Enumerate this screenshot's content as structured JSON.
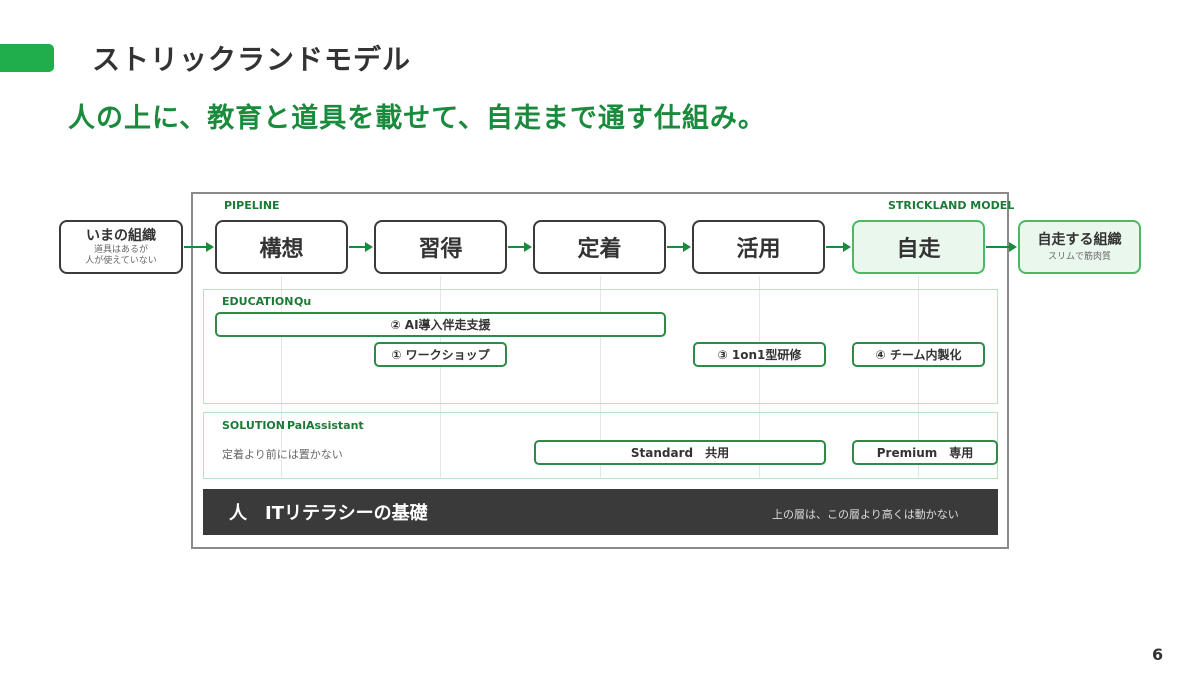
{
  "title": "ストリックランドモデル",
  "subtitle": "人の上に、教育と道具を載せて、自走まで通す仕組み。",
  "page_number": "6",
  "frame": {
    "left_tag": "PIPELINE",
    "right_tag": "STRICKLAND MODEL"
  },
  "start": {
    "title": "いまの組織",
    "sub_line1": "道具はあるが",
    "sub_line2": "人が使えていない"
  },
  "stages": [
    "構想",
    "習得",
    "定着",
    "活用",
    "自走"
  ],
  "end": {
    "title": "自走する組織",
    "sub": "スリムで筋肉質"
  },
  "education": {
    "label": "EDUCATION",
    "product": "Qu",
    "items": {
      "support": "② AI導入伴走支援",
      "workshop": "① ワークショップ",
      "training": "③ 1on1型研修",
      "internalize": "④ チーム内製化"
    }
  },
  "solution": {
    "label": "SOLUTION",
    "product": "PalAssistant",
    "note": "定着より前には置かない",
    "standard": "Standard　共用",
    "premium": "Premium　専用"
  },
  "base": {
    "label": "人　ITリテラシーの基礎",
    "note": "上の層は、この層より高くは動かない"
  },
  "colors": {
    "accent": "#1fae4b",
    "dark": "#3a3a3a",
    "highlight_bg": "#eaf7ec"
  }
}
